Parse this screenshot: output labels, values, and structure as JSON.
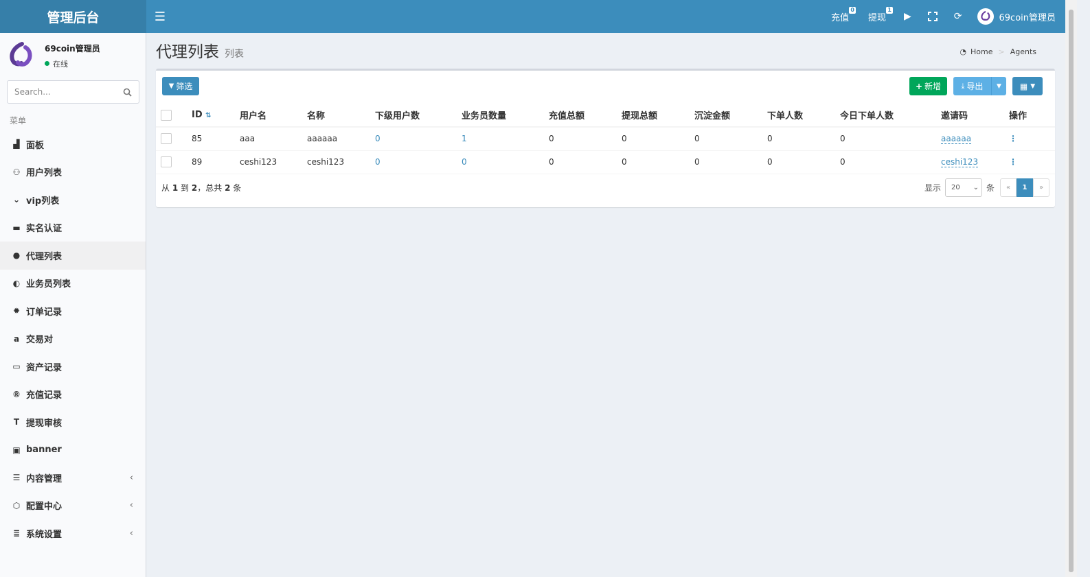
{
  "app": {
    "brand": "管理后台",
    "admin_name": "69coin管理员"
  },
  "topbar": {
    "recharge": {
      "label": "充值",
      "badge": "0"
    },
    "withdraw": {
      "label": "提现",
      "badge": "1"
    }
  },
  "sidebar": {
    "user_name": "69coin管理员",
    "status": "在线",
    "search_placeholder": "Search...",
    "menu_header": "菜单",
    "items": [
      {
        "label": "面板",
        "icon": "chart-icon"
      },
      {
        "label": "用户列表",
        "icon": "users-icon"
      },
      {
        "label": "vip列表",
        "icon": "chevron-circle-icon"
      },
      {
        "label": "实名认证",
        "icon": "credit-card-icon"
      },
      {
        "label": "代理列表",
        "icon": "arrow-circle-icon"
      },
      {
        "label": "业务员列表",
        "icon": "adjust-icon"
      },
      {
        "label": "订单记录",
        "icon": "gear-icon"
      },
      {
        "label": "交易对",
        "icon": "amazon-icon"
      },
      {
        "label": "资产记录",
        "icon": "money-icon"
      },
      {
        "label": "充值记录",
        "icon": "registered-icon"
      },
      {
        "label": "提现审核",
        "icon": "text-height-icon"
      },
      {
        "label": "banner",
        "icon": "image-icon"
      },
      {
        "label": "内容管理",
        "icon": "list-icon"
      },
      {
        "label": "配置中心",
        "icon": "hexagon-icon"
      },
      {
        "label": "系统设置",
        "icon": "server-icon"
      }
    ]
  },
  "page": {
    "title": "代理列表",
    "subtitle": "列表",
    "breadcrumb": [
      "Home",
      "Agents"
    ]
  },
  "toolbar": {
    "filter_label": "筛选",
    "add_label": "新增",
    "export_label": "导出"
  },
  "table": {
    "headers": [
      "ID",
      "用户名",
      "名称",
      "下级用户数",
      "业务员数量",
      "充值总额",
      "提现总额",
      "沉淀金额",
      "下单人数",
      "今日下单人数",
      "邀请码",
      "操作"
    ],
    "rows": [
      [
        "85",
        "aaa",
        "aaaaaa",
        "0",
        "1",
        "0",
        "0",
        "0",
        "0",
        "0",
        "aaaaaa"
      ],
      [
        "89",
        "ceshi123",
        "ceshi123",
        "0",
        "0",
        "0",
        "0",
        "0",
        "0",
        "0",
        "ceshi123"
      ]
    ]
  },
  "footer": {
    "pre": "从",
    "from": "1",
    "to_word": "到",
    "to": "2",
    "total_word": "，总共",
    "total": "2",
    "unit": "条",
    "show_label": "显示",
    "per_page": "20",
    "per_unit": "条",
    "prev": "«",
    "page": "1",
    "next": "»"
  },
  "colors": {
    "primary": "#3c8dbc",
    "success": "#00a65a",
    "export": "#5db0e5"
  }
}
